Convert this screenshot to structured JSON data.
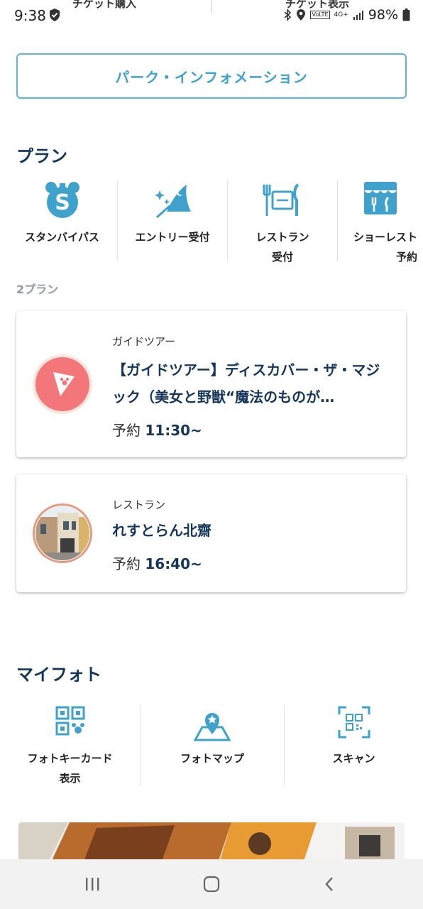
{
  "status_bar": {
    "time": "9:38",
    "battery": "98%",
    "network": "4G+"
  },
  "top_tabs": [
    "チケット購入",
    "チケット表示"
  ],
  "park_info_button": "パーク・インフォメーション",
  "plan_section": {
    "title": "プラン",
    "items": [
      {
        "label": "スタンバイパス",
        "icon": "standby-pass-icon"
      },
      {
        "label": "エントリー受付",
        "icon": "wizard-hat-icon"
      },
      {
        "label": "レストラン\n受付",
        "icon": "restaurant-icon"
      },
      {
        "label": "ショーレスト\n予約",
        "icon": "show-restaurant-icon"
      }
    ],
    "count": "2プラン",
    "cards": [
      {
        "category": "ガイドツアー",
        "title": "【ガイドツアー】ディスカバー・ザ・マジック（美女と野獣“魔法のものが…",
        "reserve_label": "予約",
        "time": "11:30~"
      },
      {
        "category": "レストラン",
        "title": "れすとらん北齋",
        "reserve_label": "予約",
        "time": "16:40~"
      }
    ]
  },
  "myphoto_section": {
    "title": "マイフォト",
    "items": [
      {
        "label": "フォトキーカード\n表示",
        "icon": "qr-code-icon"
      },
      {
        "label": "フォトマップ",
        "icon": "photo-map-icon"
      },
      {
        "label": "スキャン",
        "icon": "scan-icon"
      }
    ]
  },
  "colors": {
    "accent": "#3fa2cc",
    "navy": "#14365a",
    "tour": "#f2767a"
  }
}
